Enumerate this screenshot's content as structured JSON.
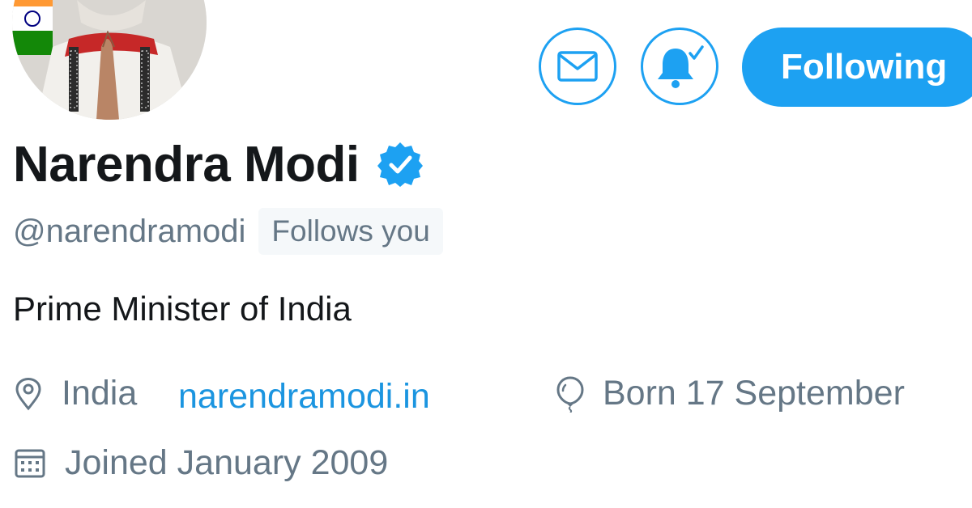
{
  "profile": {
    "display_name": "Narendra Modi",
    "handle": "@narendramodi",
    "follows_you_badge": "Follows you",
    "bio": "Prime Minister of India",
    "verified": true,
    "location": "India",
    "website": "narendramodi.in",
    "birthday": "Born 17 September",
    "joined": "Joined January 2009"
  },
  "actions": {
    "message_icon": "envelope-icon",
    "notify_icon": "bell-check-icon",
    "following_label": "Following"
  },
  "icons": {
    "location": "location-pin-icon",
    "birthday": "balloon-icon",
    "joined": "calendar-icon",
    "verified": "verified-badge-icon"
  },
  "colors": {
    "accent": "#1da1f2",
    "link": "#1b95e0",
    "text_primary": "#14171a",
    "text_secondary": "#657786",
    "badge_bg": "#f5f8fa"
  }
}
